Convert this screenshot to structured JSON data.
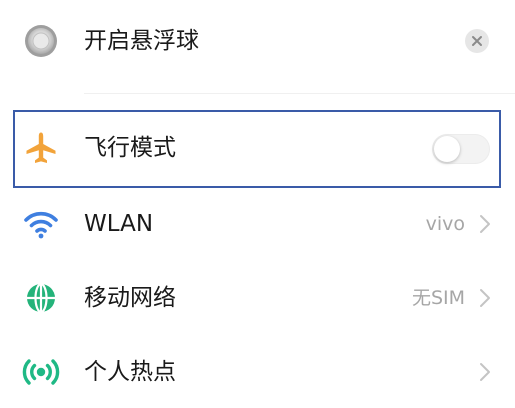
{
  "rows": {
    "float_ball": {
      "label": "开启悬浮球",
      "icon": "float-ball-icon"
    },
    "airplane": {
      "label": "飞行模式",
      "icon": "airplane-icon",
      "toggle_on": false
    },
    "wlan": {
      "label": "WLAN",
      "value": "vivo",
      "icon": "wifi-icon"
    },
    "mobile_network": {
      "label": "移动网络",
      "value": "无SIM",
      "icon": "globe-icon"
    },
    "hotspot": {
      "label": "个人热点",
      "value": "",
      "icon": "hotspot-icon"
    }
  },
  "colors": {
    "airplane_icon": "#f2a33a",
    "wifi_icon": "#3f7fe0",
    "globe_icon": "#24b37a",
    "hotspot_icon": "#1fb985",
    "highlight_border": "#3a5ba8",
    "secondary_text": "#a6a6a6"
  }
}
